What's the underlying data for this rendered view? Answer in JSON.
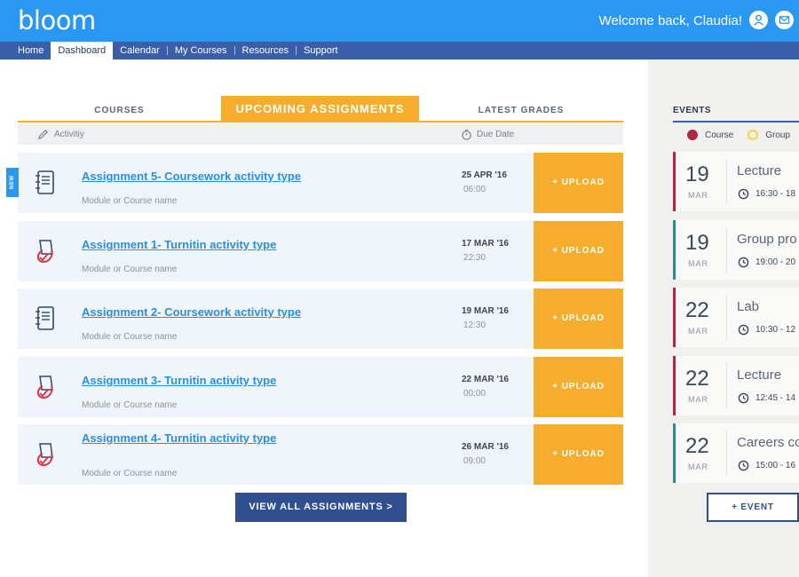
{
  "app": {
    "logo": "bloom",
    "welcome": "Welcome back, Claudia!"
  },
  "nav": [
    "Home",
    "Dashboard",
    "Calendar",
    "My Courses",
    "Resources",
    "Support"
  ],
  "tabs": [
    "COURSES",
    "UPCOMING ASSIGNMENTS",
    "LATEST GRADES"
  ],
  "columns": {
    "activity": "Activitiy",
    "due": "Due Date"
  },
  "badge": "NEW",
  "upload_label": "+ UPLOAD",
  "assignments": [
    {
      "title": "Assignment 5- Coursework activity type",
      "module": "Module or Course name",
      "date": "25 APR '16",
      "time": "06:00",
      "icon": "notebook-icon"
    },
    {
      "title": "Assignment 1- Turnitin activity type",
      "module": "Module or Course name",
      "date": "17 MAR '16",
      "time": "22:30",
      "icon": "turnitin-icon"
    },
    {
      "title": "Assignment 2- Coursework activity type",
      "module": "Module or Course name",
      "date": "19 MAR '16",
      "time": "12:30",
      "icon": "notebook-icon"
    },
    {
      "title": "Assignment 3- Turnitin activity type",
      "module": "Module or Course name",
      "date": "22 MAR '16",
      "time": "00:00",
      "icon": "turnitin-icon"
    },
    {
      "title": "Assignment 4- Turnitin activity type",
      "module": "Module or Course name",
      "date": "26 MAR '16",
      "time": "09:00",
      "icon": "turnitin-icon"
    }
  ],
  "view_all": "VIEW ALL ASSIGNMENTS >",
  "events": {
    "title": "EVENTS",
    "legend": {
      "course": "Course",
      "group": "Group"
    },
    "items": [
      {
        "day": "19",
        "month": "MAR",
        "name": "Lecture",
        "time": "16:30 - 18",
        "type": "course"
      },
      {
        "day": "19",
        "month": "MAR",
        "name": "Group pro",
        "time": "19:00 - 20",
        "type": "group"
      },
      {
        "day": "22",
        "month": "MAR",
        "name": "Lab",
        "time": "10:30 - 12",
        "type": "course"
      },
      {
        "day": "22",
        "month": "MAR",
        "name": "Lecture",
        "time": "12:45 - 14",
        "type": "course"
      },
      {
        "day": "22",
        "month": "MAR",
        "name": "Careers co",
        "time": "15:00 - 16",
        "type": "group"
      }
    ],
    "add_label": "+ EVENT"
  },
  "colors": {
    "header": "#2a97f0",
    "nav": "#3a5ea8",
    "accent": "#f6ad2d",
    "link": "#2a8fe0",
    "course": "#b0283f",
    "group": "#2e8c8c",
    "group_legend": "#f2d43a"
  }
}
